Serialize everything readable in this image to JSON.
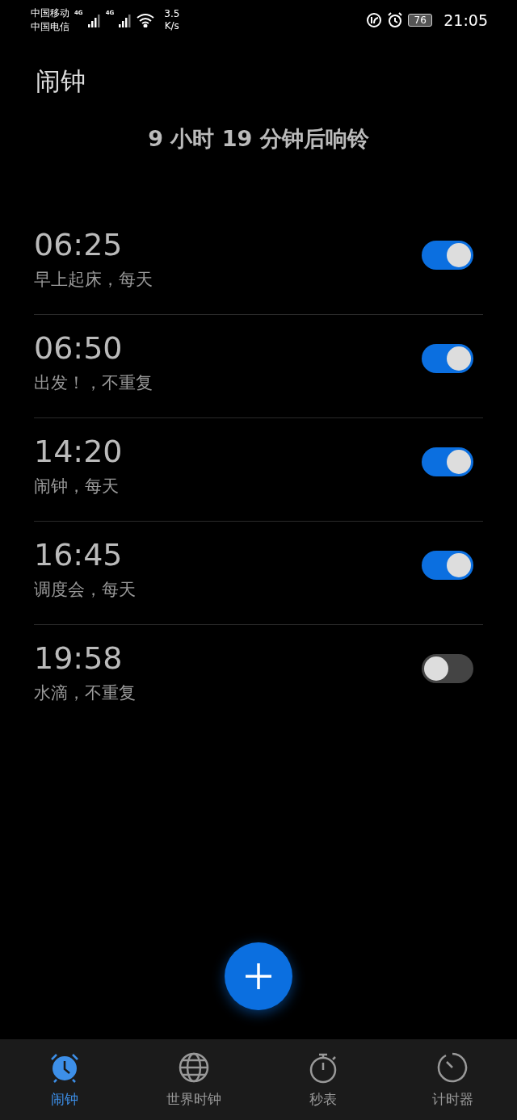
{
  "status_bar": {
    "carriers": [
      "中国移动",
      "中国电信"
    ],
    "network_labels": [
      "4G",
      "4G"
    ],
    "speed": [
      "3.5",
      "K/s"
    ],
    "battery": "76",
    "time": "21:05"
  },
  "title": "闹钟",
  "next_alarm": "9 小时 19 分钟后响铃",
  "alarms": [
    {
      "time": "06:25",
      "label": "早上起床，每天",
      "on": true
    },
    {
      "time": "06:50",
      "label": "出发！，不重复",
      "on": true
    },
    {
      "time": "14:20",
      "label": "闹钟，每天",
      "on": true
    },
    {
      "time": "16:45",
      "label": "调度会，每天",
      "on": true
    },
    {
      "time": "19:58",
      "label": "水滴，不重复",
      "on": false
    }
  ],
  "tabs": [
    {
      "kind": "alarm",
      "label": "闹钟",
      "selected": true
    },
    {
      "kind": "world",
      "label": "世界时钟",
      "selected": false
    },
    {
      "kind": "stopwatch",
      "label": "秒表",
      "selected": false
    },
    {
      "kind": "timer",
      "label": "计时器",
      "selected": false
    }
  ]
}
